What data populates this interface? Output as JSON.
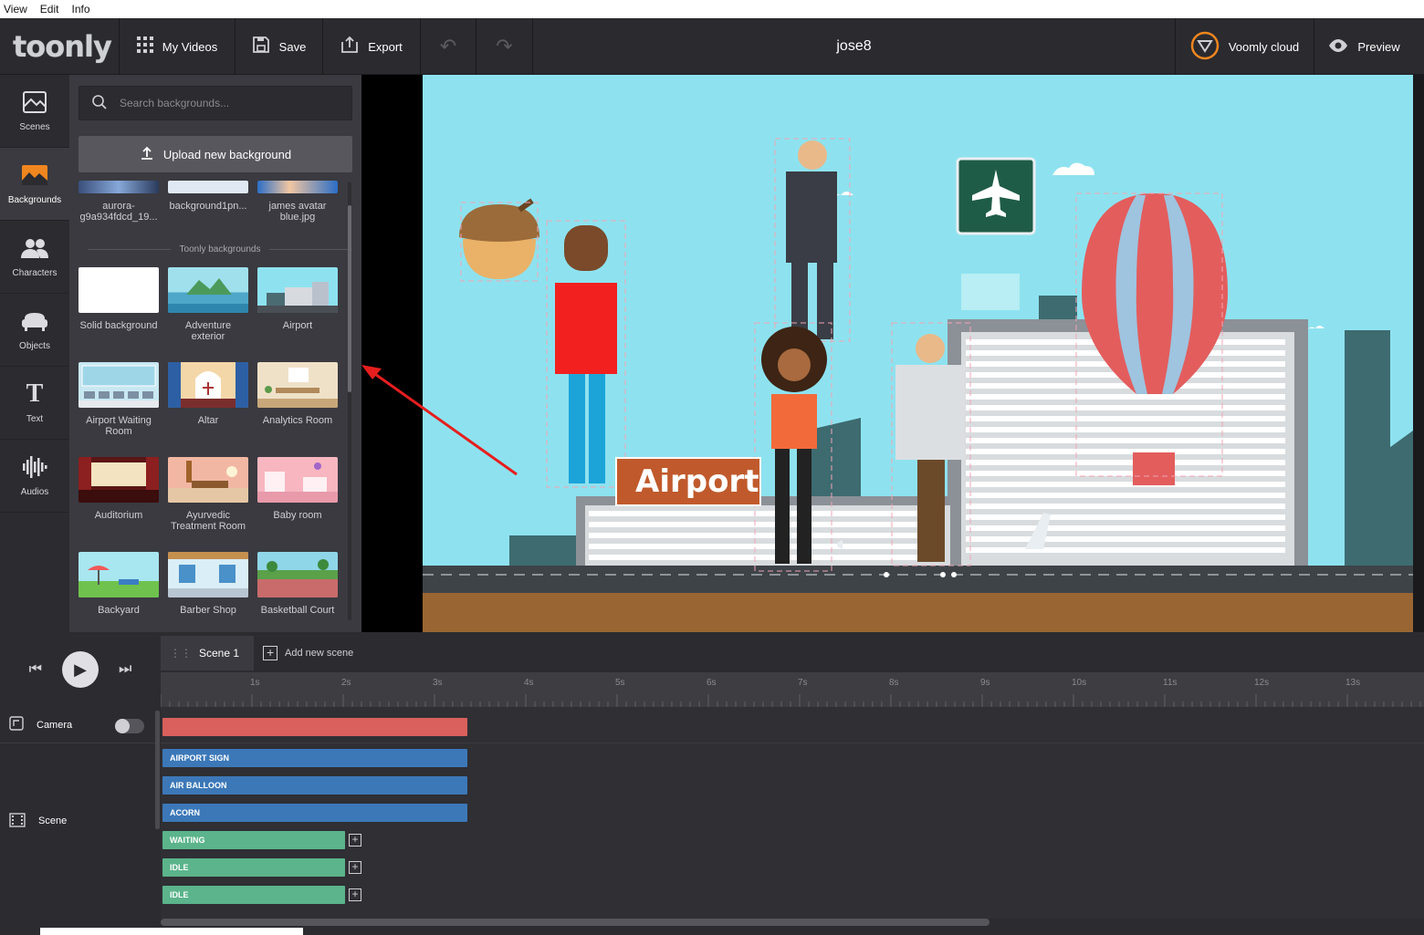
{
  "menu": [
    "View",
    "Edit",
    "Info"
  ],
  "logo": "toonly",
  "toolbar": {
    "my_videos": "My Videos",
    "save": "Save",
    "export": "Export",
    "project_title": "jose8",
    "voomly": "Voomly cloud",
    "preview": "Preview"
  },
  "sidebar": {
    "items": [
      {
        "label": "Scenes",
        "icon": "scenes-icon"
      },
      {
        "label": "Backgrounds",
        "icon": "backgrounds-icon"
      },
      {
        "label": "Characters",
        "icon": "characters-icon"
      },
      {
        "label": "Objects",
        "icon": "objects-icon"
      },
      {
        "label": "Text",
        "icon": "text-icon"
      },
      {
        "label": "Audios",
        "icon": "audios-icon"
      }
    ]
  },
  "panel": {
    "search_placeholder": "Search backgrounds...",
    "upload_label": "Upload new background",
    "uploaded": [
      {
        "label": "aurora-\ng9a934fdcd_19..."
      },
      {
        "label": "background1pn..."
      },
      {
        "label": "james avatar\nblue.jpg"
      }
    ],
    "section_label": "Toonly backgrounds",
    "backgrounds": [
      {
        "label": "Solid background"
      },
      {
        "label": "Adventure\nexterior"
      },
      {
        "label": "Airport"
      },
      {
        "label": "Airport Waiting\nRoom"
      },
      {
        "label": "Altar"
      },
      {
        "label": "Analytics Room"
      },
      {
        "label": "Auditorium"
      },
      {
        "label": "Ayurvedic\nTreatment Room"
      },
      {
        "label": "Baby room"
      },
      {
        "label": "Backyard"
      },
      {
        "label": "Barber Shop"
      },
      {
        "label": "Basketball Court"
      }
    ]
  },
  "canvas": {
    "sign_text": "Airport"
  },
  "timeline": {
    "scene_tab": "Scene 1",
    "add_scene": "Add new scene",
    "ticks": [
      "1s",
      "2s",
      "3s",
      "4s",
      "5s",
      "6s",
      "7s",
      "8s",
      "9s",
      "10s",
      "11s",
      "12s",
      "13s"
    ],
    "camera_label": "Camera",
    "scene_label": "Scene",
    "tracks": [
      {
        "label": "AIRPORT SIGN",
        "kind": "blue"
      },
      {
        "label": "AIR BALLOON",
        "kind": "blue"
      },
      {
        "label": "ACORN",
        "kind": "blue"
      },
      {
        "label": "WAITING",
        "kind": "green"
      },
      {
        "label": "IDLE",
        "kind": "green"
      },
      {
        "label": "IDLE",
        "kind": "green"
      }
    ]
  },
  "colors": {
    "accent_orange": "#f0861f",
    "sky": "#8ee2ef",
    "camera_bar": "#d9605c",
    "blue_track": "#3c78b8",
    "green_track": "#5bb48b"
  }
}
